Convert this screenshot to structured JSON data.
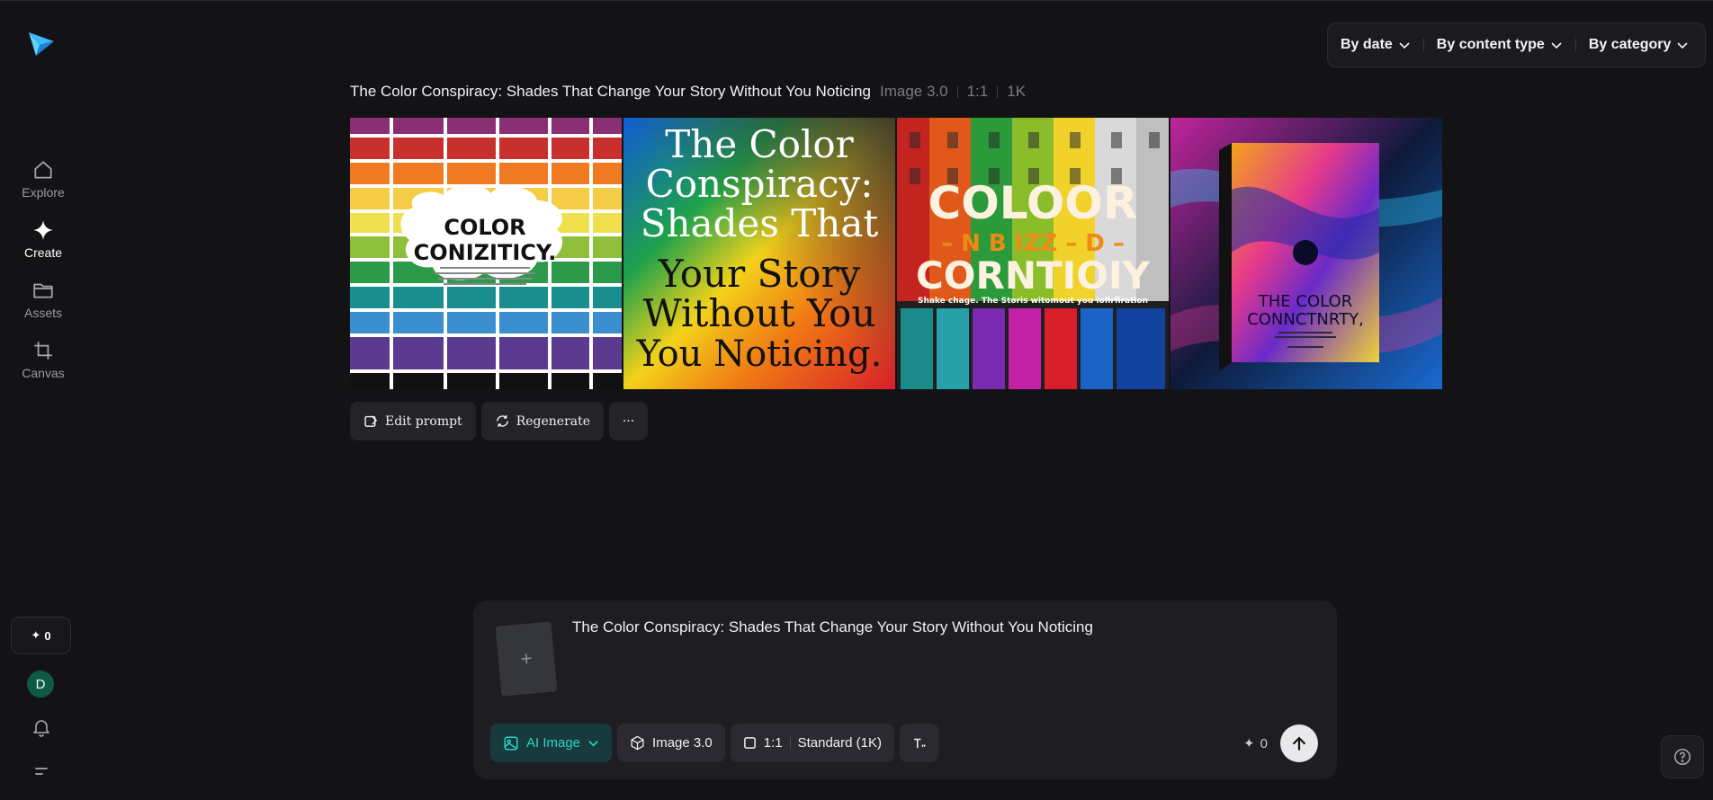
{
  "sidebar": {
    "logo_icon": "paper-plane-logo",
    "items": [
      {
        "label": "Explore",
        "icon": "home-icon"
      },
      {
        "label": "Create",
        "icon": "sparkle-icon"
      },
      {
        "label": "Assets",
        "icon": "folder-icon"
      },
      {
        "label": "Canvas",
        "icon": "crop-icon"
      }
    ],
    "credits": "0",
    "avatar_letter": "D"
  },
  "filters": {
    "by_date": "By date",
    "by_content_type": "By content type",
    "by_category": "By category"
  },
  "generation": {
    "title": "The Color Conspiracy: Shades That Change Your Story Without You Noticing",
    "model": "Image 3.0",
    "ratio": "1:1",
    "resolution": "1K",
    "images": [
      {
        "heading_1": "COLOR",
        "heading_2": "CONIZITICY."
      },
      {
        "lines": [
          "The Color",
          "Conspiracy:",
          "Shades That",
          "Your Story",
          "Without You",
          "You Noticing."
        ]
      },
      {
        "heading_1": "COLOOR",
        "subline": "– N B IZZ – D –",
        "heading_2": "CORNTIOIY",
        "caption": "Shake chage. The Storis witomout you iofirfiration"
      },
      {
        "heading_1": "THE COLOR",
        "heading_2": "CONNCTNRTY,"
      }
    ]
  },
  "actions": {
    "edit_prompt": "Edit prompt",
    "regenerate": "Regenerate",
    "more": "···"
  },
  "prompt": {
    "text": "The Color Conspiracy: Shades That Change Your Story Without You Noticing",
    "upload_symbol": "+",
    "mode": "AI Image",
    "model": "Image 3.0",
    "ratio": "1:1",
    "quality": "Standard (1K)",
    "cost": "0"
  },
  "colors": {
    "background": "#131316",
    "accent_teal": "#2ad2c6",
    "avatar_bg": "#0f5a47"
  }
}
